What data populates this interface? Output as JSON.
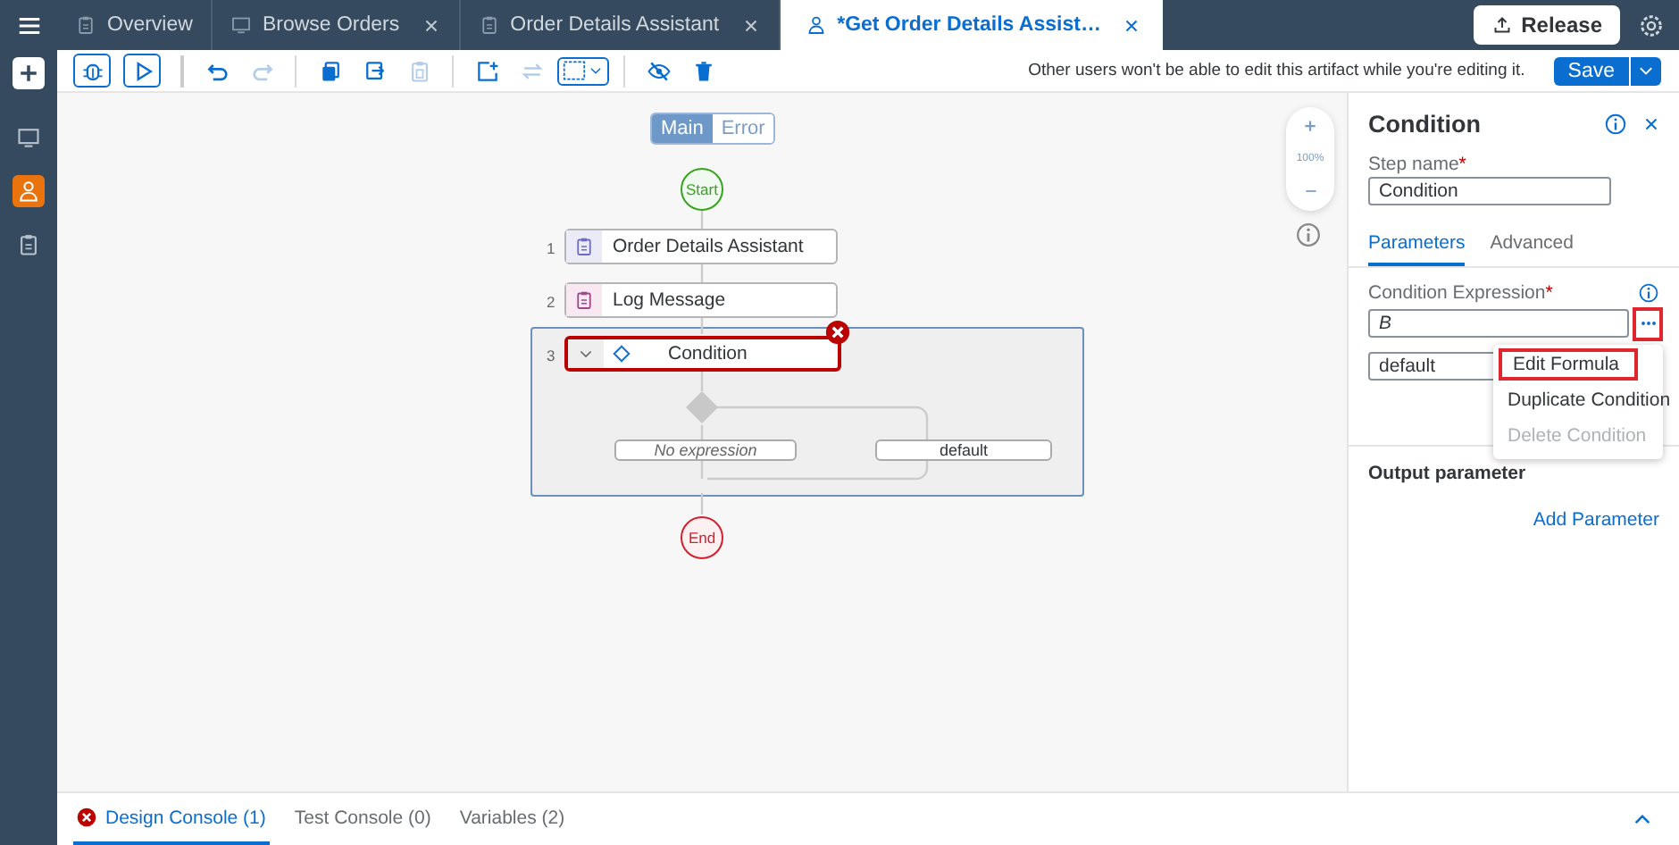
{
  "tabs": [
    {
      "label": "Overview",
      "kind": "document",
      "selected": false,
      "closable": false
    },
    {
      "label": "Browse Orders",
      "kind": "screen",
      "selected": false,
      "closable": true
    },
    {
      "label": "Order Details Assistant",
      "kind": "document",
      "selected": false,
      "closable": true
    },
    {
      "label": "*Get Order Details Assist…",
      "kind": "process",
      "selected": true,
      "closable": true
    }
  ],
  "release_button": "Release",
  "rail": [
    {
      "kind": "monitor",
      "selected": false
    },
    {
      "kind": "person",
      "selected": true
    },
    {
      "kind": "clipboard",
      "selected": false
    }
  ],
  "toolbar": [
    {
      "kind": "debug",
      "disabled": false
    },
    {
      "kind": "run",
      "disabled": false
    },
    {
      "kind": "separator"
    },
    {
      "kind": "undo",
      "disabled": false
    },
    {
      "kind": "redo",
      "disabled": true
    },
    {
      "kind": "separator"
    },
    {
      "kind": "copy",
      "disabled": false
    },
    {
      "kind": "duplicate",
      "disabled": false
    },
    {
      "kind": "paste",
      "disabled": true
    },
    {
      "kind": "separator"
    },
    {
      "kind": "frame",
      "disabled": false
    },
    {
      "kind": "swap",
      "disabled": true
    },
    {
      "kind": "select",
      "disabled": false
    },
    {
      "kind": "separator"
    },
    {
      "kind": "hide",
      "disabled": false
    },
    {
      "kind": "delete",
      "disabled": false
    }
  ],
  "edit_notice": "Other users won't be able to edit this artifact while you're editing it.",
  "save_button": "Save",
  "canvas": {
    "view_toggle": [
      {
        "label": "Main",
        "selected": true
      },
      {
        "label": "Error",
        "selected": false
      }
    ],
    "zoom": "100%",
    "start": "Start",
    "steps": [
      {
        "number": "1",
        "label": "Order Details Assistant",
        "kind": "assistant",
        "error": false
      },
      {
        "number": "2",
        "label": "Log Message",
        "kind": "log",
        "error": false
      },
      {
        "number": "3",
        "label": "Condition",
        "kind": "condition",
        "error": true
      }
    ],
    "branches": [
      {
        "label": "No expression",
        "empty": true
      },
      {
        "label": "default",
        "empty": false
      }
    ],
    "end": "End"
  },
  "panel": {
    "title": "Condition",
    "step_name": {
      "label": "Step name",
      "required_mark": "*",
      "value": "Condition"
    },
    "tabs": [
      {
        "label": "Parameters",
        "selected": true
      },
      {
        "label": "Advanced",
        "selected": false
      }
    ],
    "expression": {
      "label": "Condition Expression",
      "required_mark": "*",
      "value": "B",
      "highlighted": true
    },
    "default_field": "default",
    "menu": [
      {
        "label": "Edit Formula",
        "highlighted": true,
        "disabled": false
      },
      {
        "label": "Duplicate Condition",
        "highlighted": false,
        "disabled": false
      },
      {
        "label": "Delete Condition",
        "highlighted": false,
        "disabled": true
      }
    ],
    "output_title": "Output parameter",
    "add_parameter": "Add Parameter"
  },
  "console": [
    {
      "label": "Design Console (1)",
      "selected": true,
      "error": true
    },
    {
      "label": "Test Console (0)",
      "selected": false,
      "error": false
    },
    {
      "label": "Variables (2)",
      "selected": false,
      "error": false
    }
  ]
}
